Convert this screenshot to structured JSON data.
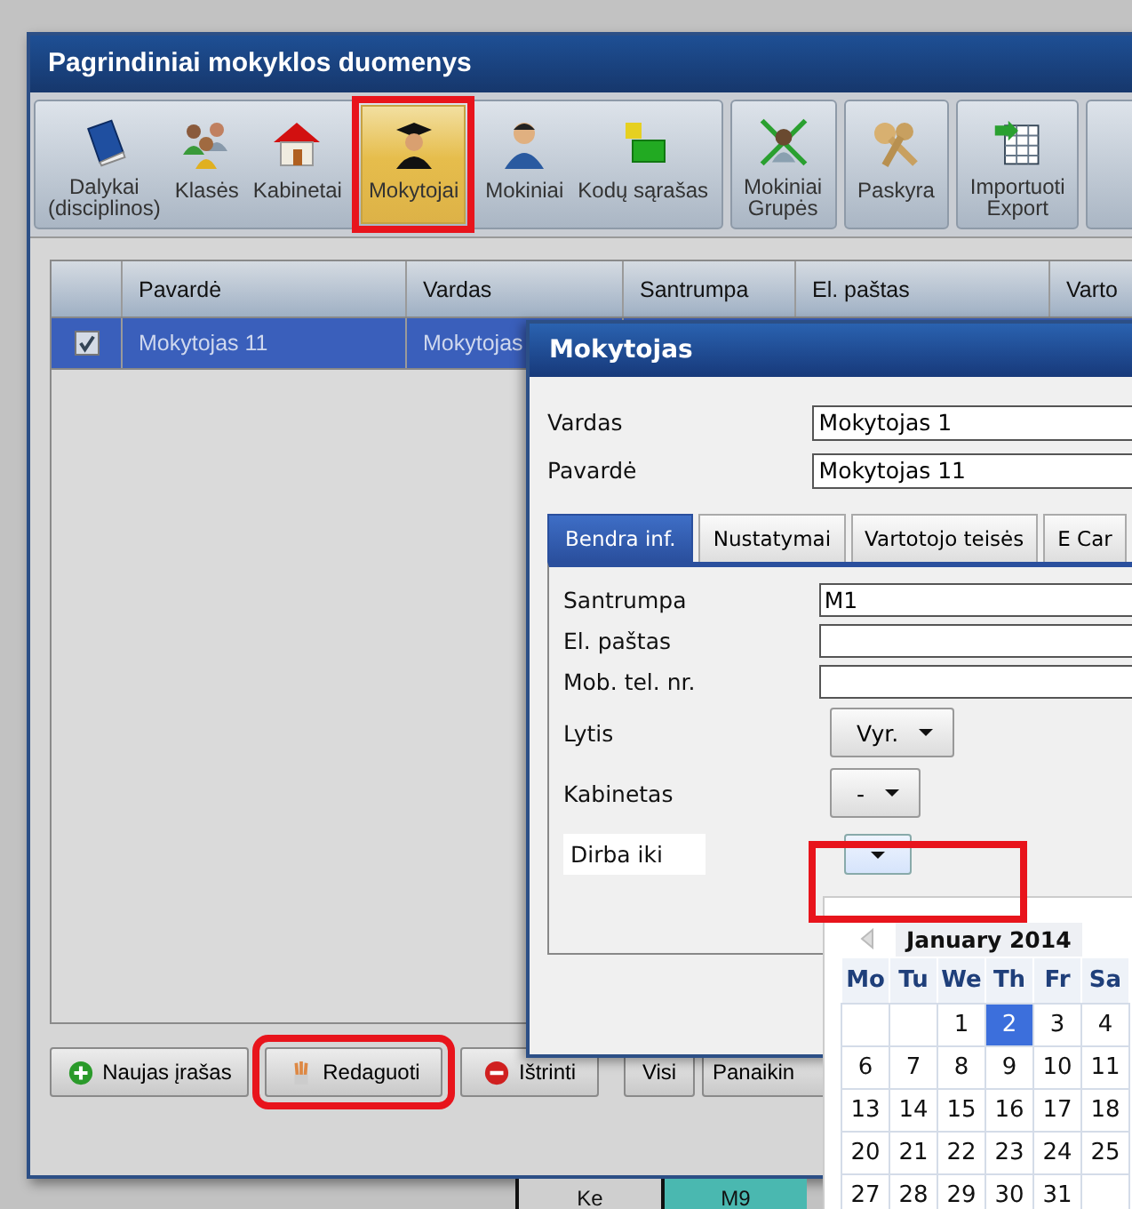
{
  "window": {
    "title": "Pagrindiniai mokyklos duomenys"
  },
  "toolbar": {
    "groups": [
      {
        "items": [
          {
            "lines": [
              "Dalykai",
              "(disciplinos)"
            ],
            "kind": "book",
            "selected": false
          },
          {
            "lines": [
              "Klasės"
            ],
            "kind": "people",
            "selected": false
          },
          {
            "lines": [
              "Kabinetai"
            ],
            "kind": "house",
            "selected": false
          },
          {
            "lines": [
              "Mokytojai"
            ],
            "kind": "graduate",
            "selected": true
          },
          {
            "lines": [
              "Mokiniai"
            ],
            "kind": "person",
            "selected": false
          },
          {
            "lines": [
              "Kodų sąrašas"
            ],
            "kind": "blocks",
            "selected": false
          }
        ]
      },
      {
        "items": [
          {
            "lines": [
              "Mokiniai",
              "Grupės"
            ],
            "kind": "arrows",
            "selected": false
          }
        ]
      },
      {
        "items": [
          {
            "lines": [
              "Paskyra"
            ],
            "kind": "keys",
            "selected": false
          }
        ]
      },
      {
        "items": [
          {
            "lines": [
              "Importuoti",
              "Export"
            ],
            "kind": "table",
            "selected": false
          }
        ]
      }
    ]
  },
  "table": {
    "columns": [
      "Pavardė",
      "Vardas",
      "Santrumpa",
      "El. paštas",
      "Varto"
    ],
    "rows": [
      {
        "checked": true,
        "selected": true,
        "cells": [
          "Mokytojas 11",
          "Mokytojas"
        ]
      }
    ]
  },
  "buttons": [
    {
      "label": "Naujas įrašas",
      "kind": "plus"
    },
    {
      "label": "Redaguoti",
      "kind": "pencils"
    },
    {
      "label": "Ištrinti",
      "kind": "minus"
    },
    {
      "label": "Visi",
      "kind": "plain"
    },
    {
      "label": "Panaikin",
      "kind": "plain"
    }
  ],
  "background_timetable": {
    "cells": [
      {
        "text": "Ke",
        "kind": "plain"
      },
      {
        "text": "M9",
        "kind": "teal"
      }
    ]
  },
  "dialog": {
    "title": "Mokytojas",
    "fields": [
      {
        "label": "Vardas",
        "value": "Mokytojas 1"
      },
      {
        "label": "Pavardė",
        "value": "Mokytojas 11"
      }
    ],
    "tabs": [
      {
        "label": "Bendra inf.",
        "selected": true
      },
      {
        "label": "Nustatymai",
        "selected": false
      },
      {
        "label": "Vartotojo teisės",
        "selected": false
      },
      {
        "label": "E Car",
        "selected": false
      }
    ],
    "tab_fields": [
      {
        "label": "Santrumpa",
        "kind": "text",
        "value": "M1"
      },
      {
        "label": "El. paštas",
        "kind": "text"
      },
      {
        "label": "Mob. tel. nr.",
        "kind": "text"
      },
      {
        "label": "Lytis",
        "kind": "dropdown",
        "value": "Vyr."
      },
      {
        "label": "Kabinetas",
        "kind": "dropdown",
        "value": "-"
      },
      {
        "label": "Dirba iki",
        "kind": "date"
      }
    ]
  },
  "calendar": {
    "month": "January 2014",
    "weekdays": [
      "Mo",
      "Tu",
      "We",
      "Th",
      "Fr",
      "Sa"
    ],
    "weeks": [
      [
        {
          "selected": false
        },
        {
          "selected": false
        },
        {
          "day": "1",
          "selected": false
        },
        {
          "day": "2",
          "selected": true
        },
        {
          "day": "3",
          "selected": false
        },
        {
          "day": "4",
          "selected": false
        }
      ],
      [
        {
          "day": "6",
          "selected": false
        },
        {
          "day": "7",
          "selected": false
        },
        {
          "day": "8",
          "selected": false
        },
        {
          "day": "9",
          "selected": false
        },
        {
          "day": "10",
          "selected": false
        },
        {
          "day": "11",
          "selected": false
        }
      ],
      [
        {
          "day": "13",
          "selected": false
        },
        {
          "day": "14",
          "selected": false
        },
        {
          "day": "15",
          "selected": false
        },
        {
          "day": "16",
          "selected": false
        },
        {
          "day": "17",
          "selected": false
        },
        {
          "day": "18",
          "selected": false
        }
      ],
      [
        {
          "day": "20",
          "selected": false
        },
        {
          "day": "21",
          "selected": false
        },
        {
          "day": "22",
          "selected": false
        },
        {
          "day": "23",
          "selected": false
        },
        {
          "day": "24",
          "selected": false
        },
        {
          "day": "25",
          "selected": false
        }
      ],
      [
        {
          "day": "27",
          "selected": false
        },
        {
          "day": "28",
          "selected": false
        },
        {
          "day": "29",
          "selected": false
        },
        {
          "day": "30",
          "selected": false
        },
        {
          "day": "31",
          "selected": false
        },
        {
          "selected": false
        }
      ]
    ]
  }
}
